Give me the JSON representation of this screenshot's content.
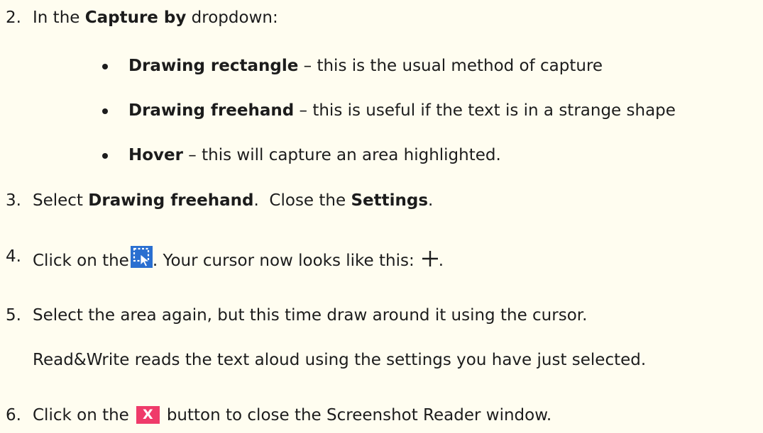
{
  "steps": {
    "s2": {
      "num": "2.",
      "pre": "In the ",
      "bold": "Capture by",
      "post": " dropdown:"
    },
    "bullets": [
      {
        "bold": "Drawing rectangle",
        "rest": " – this is the usual method of capture"
      },
      {
        "bold": "Drawing freehand",
        "rest": " – this is useful if the text is in a strange shape"
      },
      {
        "bold": "Hover",
        "rest": " – this will capture an area highlighted."
      }
    ],
    "s3": {
      "num": "3.",
      "pre": "Select ",
      "bold1": "Drawing freehand",
      "mid": ".  Close the ",
      "bold2": "Settings",
      "post": "."
    },
    "s4": {
      "num": "4.",
      "pre": "Click on the",
      "mid": ". Your cursor now looks like this:",
      "post": "."
    },
    "s5": {
      "num": "5.",
      "text": "Select the area again, but this time draw around it using the cursor.",
      "sub": "Read&Write reads the text aloud using the settings you have just selected."
    },
    "s6": {
      "num": "6.",
      "pre": "Click on the",
      "post": "button to close the Screenshot Reader window."
    }
  },
  "icons": {
    "capture_icon": {
      "name": "screenshot-capture-icon",
      "color": "#2a6fd0"
    },
    "cursor_icon": {
      "name": "crosshair-cursor-icon"
    },
    "close_icon": {
      "name": "close-icon",
      "color": "#ef3b6a",
      "glyph": "X"
    }
  }
}
